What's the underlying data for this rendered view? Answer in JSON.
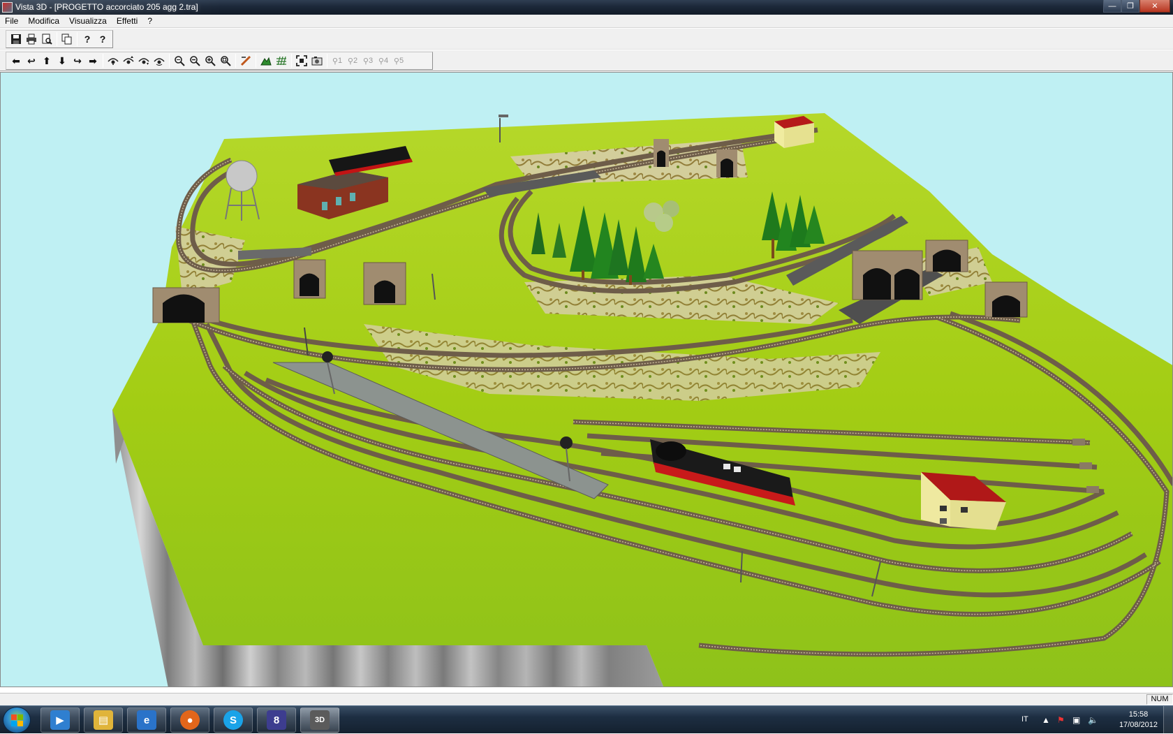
{
  "window": {
    "title": "Vista 3D - [PROGETTO accorciato 205 agg 2.tra]",
    "minimize_label": "—",
    "maximize_label": "❐",
    "close_label": "✕"
  },
  "menu": {
    "items": [
      "File",
      "Modifica",
      "Visualizza",
      "Effetti",
      "?"
    ]
  },
  "toolbar1": {
    "buttons": [
      {
        "name": "save-icon",
        "glyph": "💾"
      },
      {
        "name": "print-icon",
        "glyph": "🖶"
      },
      {
        "name": "print-preview-icon",
        "glyph": "🔍"
      },
      {
        "name": "copy-icon",
        "glyph": "⎘"
      },
      {
        "name": "help-icon",
        "glyph": "?"
      },
      {
        "name": "context-help-icon",
        "glyph": "?"
      }
    ]
  },
  "toolbar2": {
    "nav": [
      "⬅",
      "↩",
      "⬆",
      "⬇",
      "↪",
      "➡"
    ],
    "camera": [
      "camera-up-icon",
      "camera-forward-icon",
      "camera-down-icon",
      "camera-rotate-icon"
    ],
    "zoom": [
      "zoom-fit-icon",
      "zoom-out-icon",
      "zoom-in-icon",
      "zoom-window-icon"
    ],
    "layers": [
      "⌖",
      "▦",
      "▧"
    ],
    "positions_labels": [
      "1",
      "2",
      "3",
      "4",
      "5"
    ]
  },
  "status": {
    "num_indicator": "NUM"
  },
  "taskbar": {
    "apps": [
      {
        "name": "media-center-icon",
        "color": "#2f7fd0"
      },
      {
        "name": "file-explorer-icon",
        "color": "#e0b43a"
      },
      {
        "name": "internet-explorer-icon",
        "color": "#2a73c9"
      },
      {
        "name": "firefox-icon",
        "color": "#e2661b"
      },
      {
        "name": "skype-icon",
        "color": "#1aa3e8"
      },
      {
        "name": "track-planner-icon",
        "color": "#3d3d8f"
      },
      {
        "name": "vista-3d-icon",
        "color": "#5b5b5b"
      }
    ],
    "task_badge": "8",
    "active_badge": "3D",
    "language": "IT",
    "time": "15:58",
    "date": "17/08/2012"
  },
  "colors": {
    "sky": "#bff0f3",
    "grass": "#a7d21a",
    "cliff": "#9a9a9a",
    "track": "#7a6a55"
  }
}
